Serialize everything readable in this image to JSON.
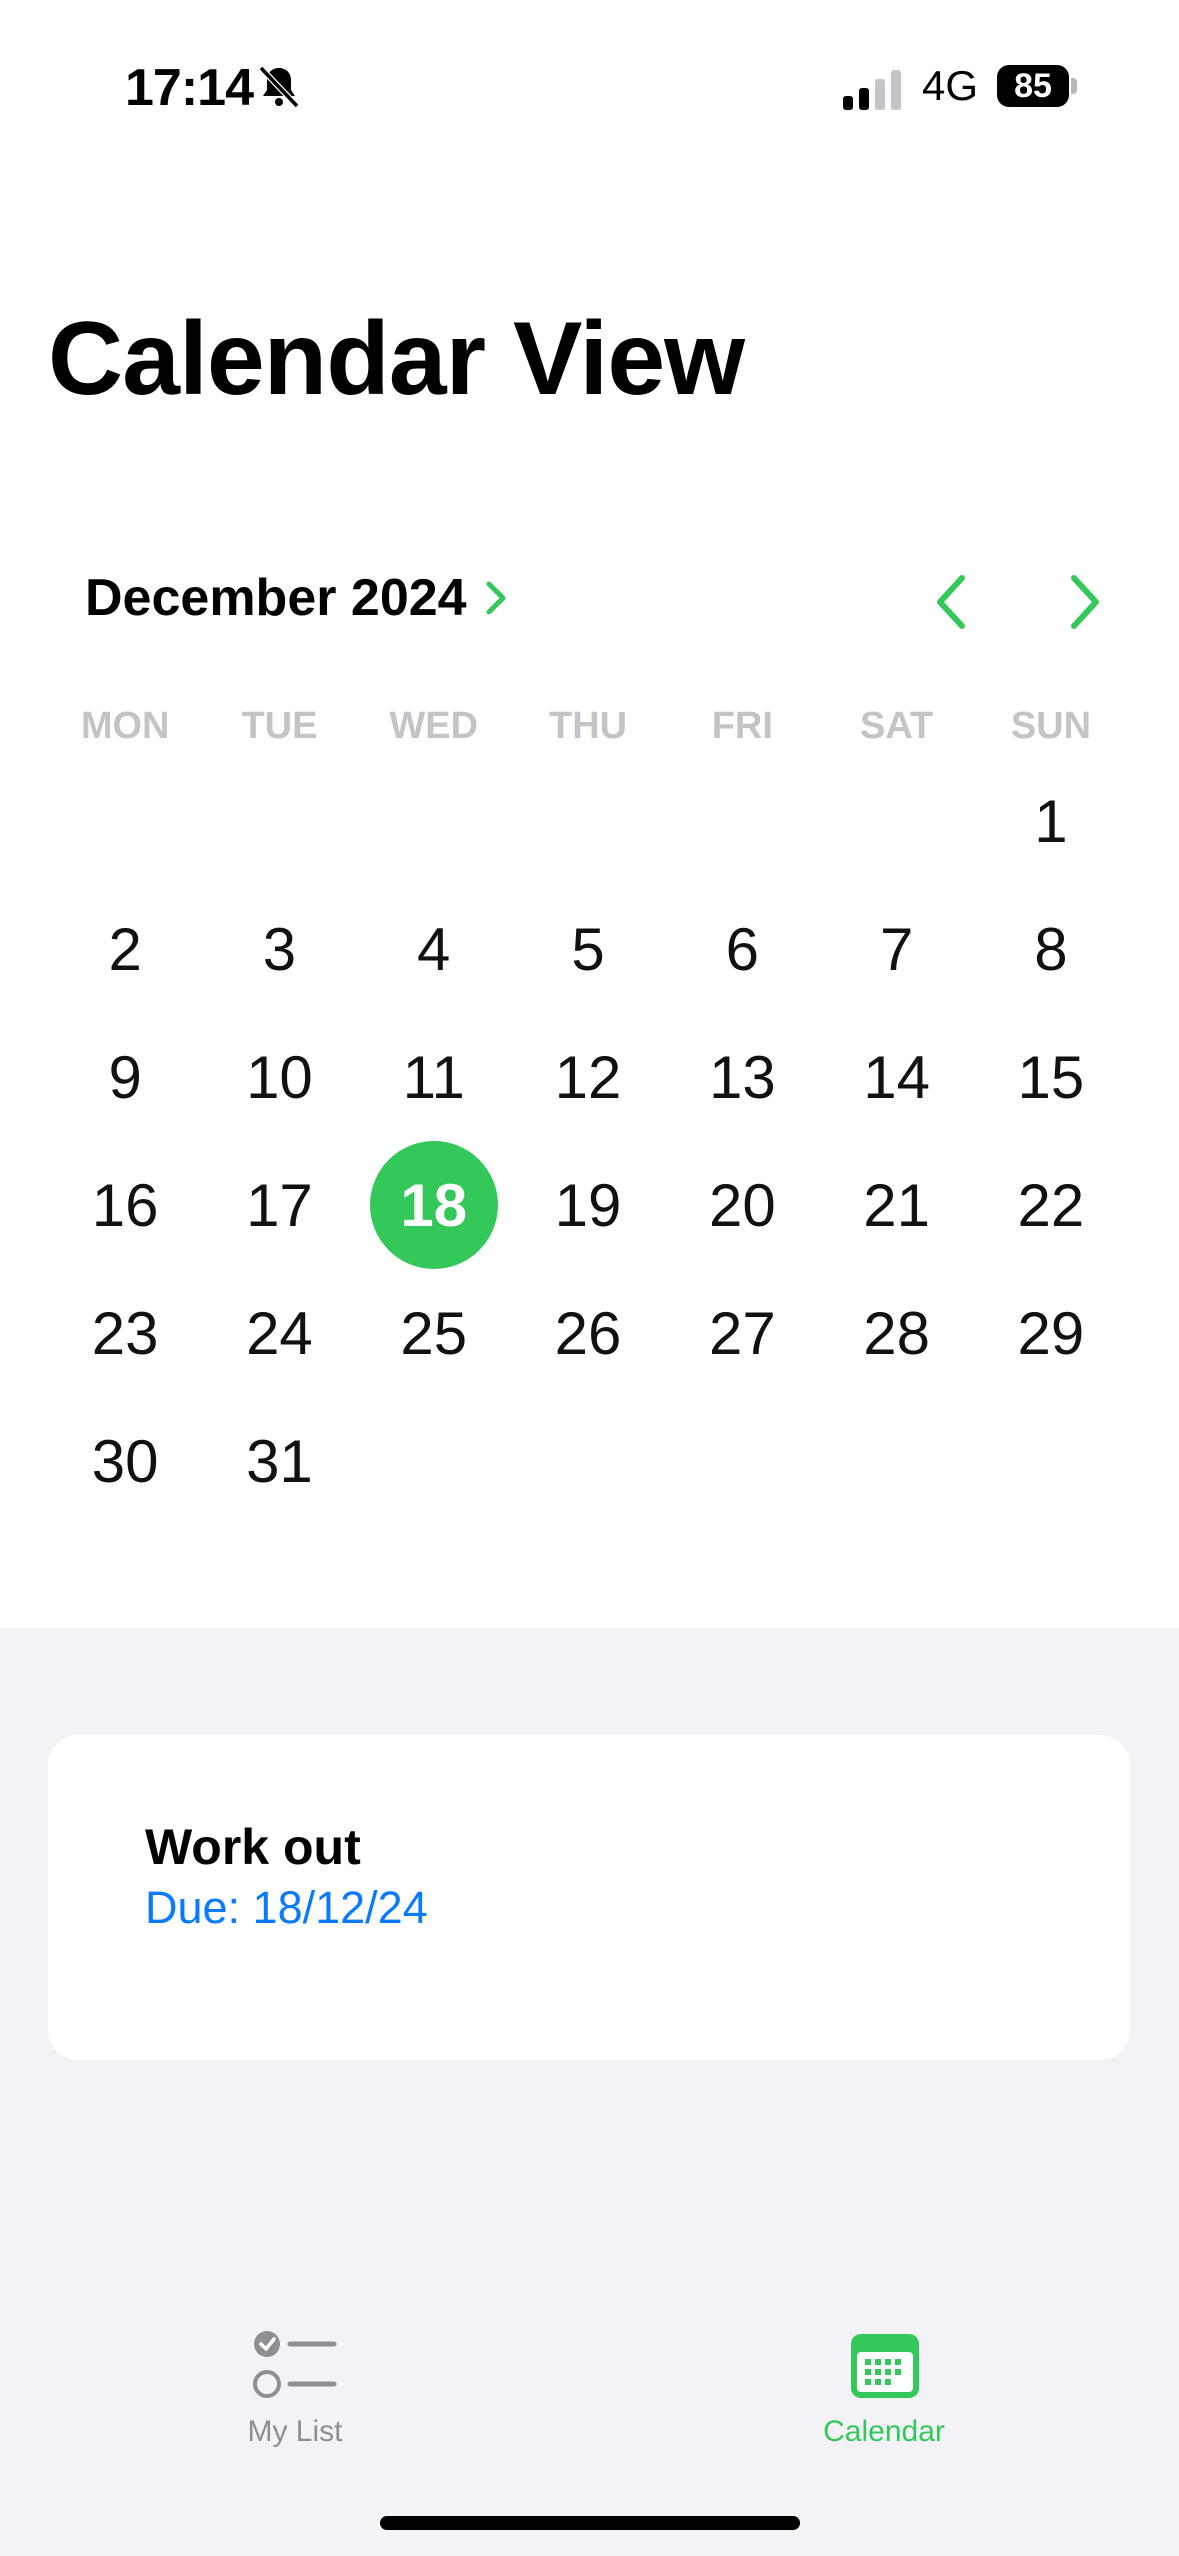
{
  "status_bar": {
    "time": "17:14",
    "network": "4G",
    "battery": "85"
  },
  "page": {
    "title": "Calendar View"
  },
  "calendar": {
    "month_label": "December 2024",
    "weekdays": [
      "MON",
      "TUE",
      "WED",
      "THU",
      "FRI",
      "SAT",
      "SUN"
    ],
    "selected_day": "18",
    "accent_color": "#34c759",
    "weeks": [
      [
        "",
        "",
        "",
        "",
        "",
        "",
        "1"
      ],
      [
        "2",
        "3",
        "4",
        "5",
        "6",
        "7",
        "8"
      ],
      [
        "9",
        "10",
        "11",
        "12",
        "13",
        "14",
        "15"
      ],
      [
        "16",
        "17",
        "18",
        "19",
        "20",
        "21",
        "22"
      ],
      [
        "23",
        "24",
        "25",
        "26",
        "27",
        "28",
        "29"
      ],
      [
        "30",
        "31",
        "",
        "",
        "",
        "",
        ""
      ]
    ]
  },
  "task": {
    "title": "Work out",
    "due": "Due: 18/12/24",
    "due_color": "#0a7aff"
  },
  "tab_bar": {
    "tabs": [
      {
        "label": "My List",
        "icon": "checklist-icon",
        "active": false
      },
      {
        "label": "Calendar",
        "icon": "calendar-icon",
        "active": true
      }
    ]
  }
}
